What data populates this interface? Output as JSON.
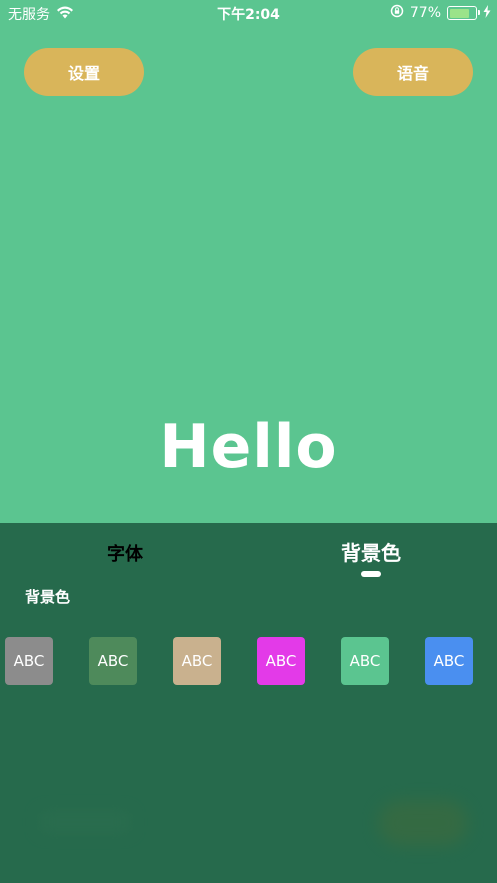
{
  "status_bar": {
    "carrier": "无服务",
    "time": "下午2:04",
    "battery_percent": "77%",
    "battery_level": 0.77
  },
  "header": {
    "settings_label": "设置",
    "voice_label": "语音"
  },
  "display": {
    "text": "Hello"
  },
  "panel": {
    "tabs": [
      {
        "label": "字体",
        "selected": false
      },
      {
        "label": "背景色",
        "selected": true
      }
    ],
    "section_label": "背景色",
    "swatches": [
      {
        "label": "ABC",
        "color": "#8c8c8c"
      },
      {
        "label": "ABC",
        "color": "#4e8a5b"
      },
      {
        "label": "ABC",
        "color": "#c9b18e"
      },
      {
        "label": "ABC",
        "color": "#e33ae8"
      },
      {
        "label": "ABC",
        "color": "#5bc590"
      },
      {
        "label": "ABC",
        "color": "#4a8ff0"
      }
    ]
  },
  "colors": {
    "background": "#5bc590",
    "panel": "#266a4c",
    "accent_button": "#d9b55a"
  }
}
